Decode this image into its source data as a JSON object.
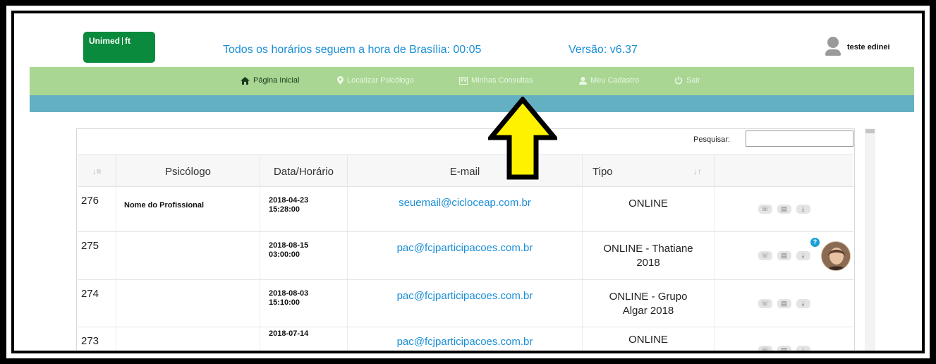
{
  "header": {
    "logo_text": "Unimed",
    "logo_suffix": "ft",
    "notice": "Todos os horários seguem a hora de Brasília: 00:05",
    "version": "Versão: v6.37",
    "user_name": "teste edinei"
  },
  "nav": {
    "items": [
      {
        "label": "Página Inicial",
        "icon": "home-icon"
      },
      {
        "label": "Localizar Psicólogo",
        "icon": "map-marker-icon"
      },
      {
        "label": "Minhas Consultas",
        "icon": "calendar-icon"
      },
      {
        "label": "Meu Cadastro",
        "icon": "user-icon"
      },
      {
        "label": "Sair",
        "icon": "power-icon"
      }
    ]
  },
  "search": {
    "label": "Pesquisar:",
    "value": ""
  },
  "table": {
    "columns": [
      "",
      "Psicólogo",
      "Data/Horário",
      "E-mail",
      "Tipo",
      ""
    ],
    "rows": [
      {
        "id": "276",
        "psychologist": "Nome do Profissional",
        "date": "2018-04-23",
        "time": "15:28:00",
        "email": "seuemail@cicloceap.com.br",
        "type_line1": "ONLINE",
        "type_line2": ""
      },
      {
        "id": "275",
        "psychologist": "",
        "date": "2018-08-15",
        "time": "03:00:00",
        "email": "pac@fcjparticipacoes.com.br",
        "type_line1": "ONLINE - Thatiane",
        "type_line2": "2018"
      },
      {
        "id": "274",
        "psychologist": "",
        "date": "2018-08-03",
        "time": "15:10:00",
        "email": "pac@fcjparticipacoes.com.br",
        "type_line1": "ONLINE - Grupo",
        "type_line2": "Algar 2018"
      },
      {
        "id": "273",
        "psychologist": "",
        "date": "2018-07-14",
        "time": "",
        "email": "pac@fcjparticipacoes.com.br",
        "type_line1": "ONLINE",
        "type_line2": ""
      }
    ],
    "help_badge": "?"
  },
  "colors": {
    "nav_green": "#a9d693",
    "bar_blue": "#63b0c2",
    "link_blue": "#1a8ed6",
    "logo_green": "#0a8a3c",
    "arrow_yellow": "#fff200"
  }
}
